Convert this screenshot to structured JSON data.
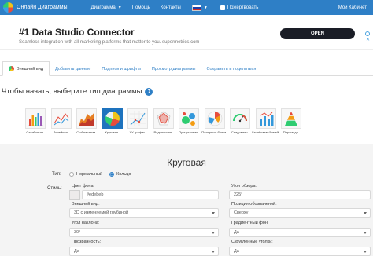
{
  "navbar": {
    "brand": "Онлайн Диаграммы",
    "links": [
      {
        "label": "Диаграмма",
        "caret": true
      },
      {
        "label": "Помощь",
        "caret": false
      },
      {
        "label": "Контакты",
        "caret": false
      }
    ],
    "donate": "Пожертвовать",
    "cabinet": "Мой Кабинет",
    "colors": {
      "bar": "#2e7fc6"
    }
  },
  "ad": {
    "title": "#1 Data Studio Connector",
    "subtitle": "Seamless integration with all marketing platforms that matter to you. supermetrics.com",
    "button": "OPEN"
  },
  "tabs": [
    {
      "label": "Внешний вид",
      "active": true
    },
    {
      "label": "Добавить данные",
      "active": false
    },
    {
      "label": "Подписи и шрифты",
      "active": false
    },
    {
      "label": "Просмотр диаграммы",
      "active": false
    },
    {
      "label": "Сохранить и поделиться",
      "active": false
    }
  ],
  "prompt": "Чтобы начать, выберите тип диаграммы",
  "chart_types": [
    {
      "label": "Столбчатая",
      "icon": "bar-chart-icon",
      "active": false
    },
    {
      "label": "Линейная",
      "icon": "line-chart-icon",
      "active": false
    },
    {
      "label": "С областями",
      "icon": "area-chart-icon",
      "active": false
    },
    {
      "label": "Круговая",
      "icon": "pie-chart-icon",
      "active": true
    },
    {
      "label": "XY график",
      "icon": "xy-chart-icon",
      "active": false
    },
    {
      "label": "Радиальная",
      "icon": "radial-chart-icon",
      "active": false
    },
    {
      "label": "Пузырьковая",
      "icon": "bubble-chart-icon",
      "active": false
    },
    {
      "label": "Полярные болки",
      "icon": "polar-chart-icon",
      "active": false
    },
    {
      "label": "Спидометр",
      "icon": "speedometer-icon",
      "active": false
    },
    {
      "label": "Столбчатая/Линейная",
      "icon": "bar-line-chart-icon",
      "active": false
    },
    {
      "label": "Пирамида",
      "icon": "pyramid-chart-icon",
      "active": false
    }
  ],
  "panel": {
    "title": "Круговая",
    "type_label": "Тип:",
    "type_options": [
      {
        "label": "Нормальный",
        "selected": false
      },
      {
        "label": "Кольцо",
        "selected": true
      }
    ],
    "style_label": "Стиль:",
    "left_fields": [
      {
        "label": "Цвет фона:",
        "value": "#edebeb"
      },
      {
        "label": "Внешний вид:",
        "value": "3D с изменяемой глубиной"
      },
      {
        "label": "Угол наклона:",
        "value": "30°"
      },
      {
        "label": "Прозрачность:",
        "value": "Да"
      }
    ],
    "right_fields": [
      {
        "label": "Угол обзора:",
        "value": "225°"
      },
      {
        "label": "Позиция обозначений:",
        "value": "Сверху"
      },
      {
        "label": "Градиентный фон:",
        "value": "Да"
      },
      {
        "label": "Скругленные уголки:",
        "value": "Да"
      }
    ]
  }
}
